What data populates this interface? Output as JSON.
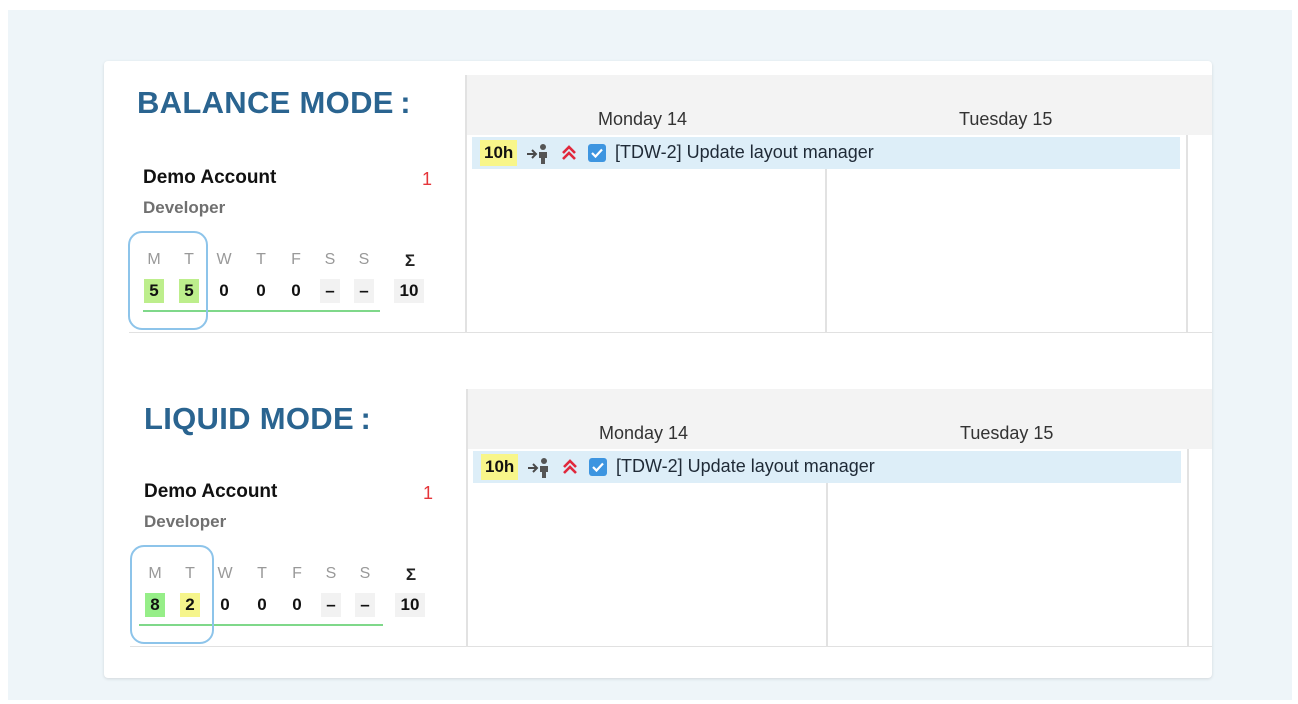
{
  "balance": {
    "title": "BALANCE MODE :",
    "account": {
      "name": "Demo Account",
      "role": "Developer",
      "count": "1"
    },
    "days": {
      "letters": [
        "M",
        "T",
        "W",
        "T",
        "F",
        "S",
        "S"
      ],
      "sum_symbol": "Σ",
      "values": [
        "5",
        "5",
        "0",
        "0",
        "0",
        "–",
        "–"
      ],
      "total": "10"
    },
    "calendar": {
      "day1": "Monday 14",
      "day2": "Tuesday 15",
      "task": {
        "hours": "10h",
        "label": "[TDW-2] Update layout manager"
      }
    }
  },
  "liquid": {
    "title": "LIQUID MODE :",
    "account": {
      "name": "Demo Account",
      "role": "Developer",
      "count": "1"
    },
    "days": {
      "letters": [
        "M",
        "T",
        "W",
        "T",
        "F",
        "S",
        "S"
      ],
      "sum_symbol": "Σ",
      "values": [
        "8",
        "2",
        "0",
        "0",
        "0",
        "–",
        "–"
      ],
      "total": "10"
    },
    "calendar": {
      "day1": "Monday 14",
      "day2": "Tuesday 15",
      "task": {
        "hours": "10h",
        "label": "[TDW-2] Update layout manager"
      }
    }
  },
  "colors": {
    "title": "#2a6490",
    "count_red": "#e5353a",
    "highlight_border": "#8dc4ea",
    "task_bar": "#ddeef8",
    "hours_badge": "#f8f68a",
    "green_value": "#bdee8c",
    "bright_green_value": "#96ee88",
    "yellow_value": "#f6f58c",
    "priority_red": "#e0283c",
    "checkbox_blue": "#3d95e0"
  },
  "icons": {
    "assignee": "assign-person-icon",
    "priority": "double-chevron-up-icon",
    "type": "checkbox-task-icon"
  }
}
